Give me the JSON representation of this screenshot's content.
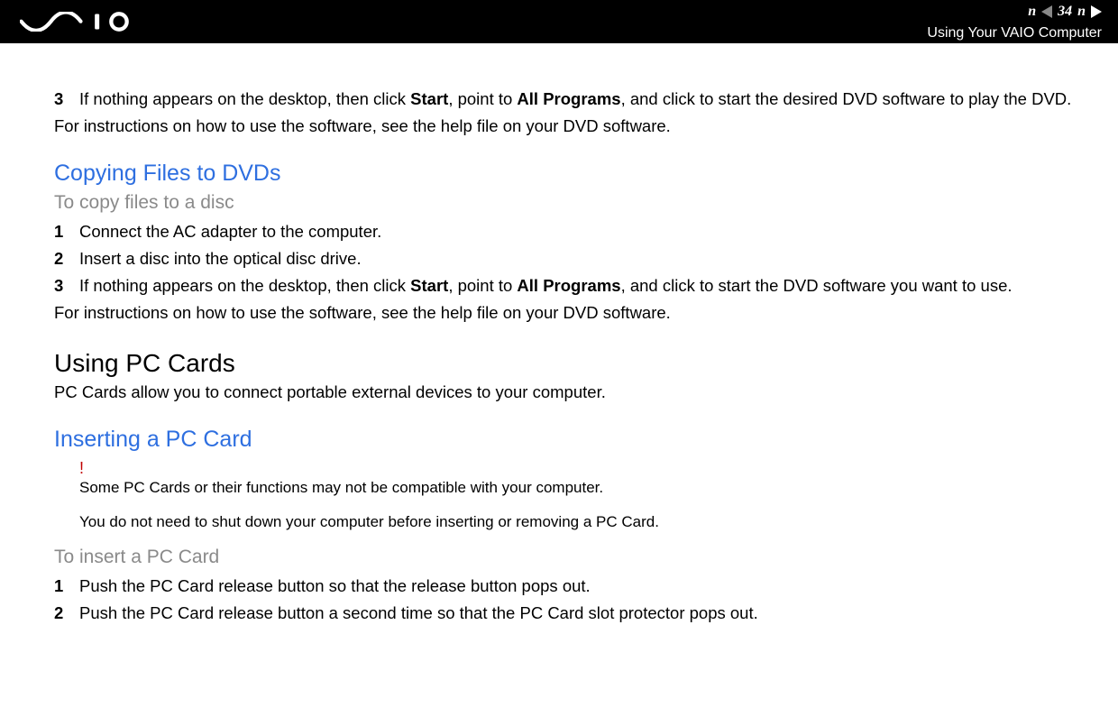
{
  "header": {
    "page_number": "34",
    "n_letter": "n",
    "section": "Using Your VAIO Computer"
  },
  "body": {
    "step3_num": "3",
    "step3_pre": "If nothing appears on the desktop, then click ",
    "step3_b1": "Start",
    "step3_mid1": ", point to ",
    "step3_b2": "All Programs",
    "step3_post": ", and click to start the desired DVD software to play the DVD.",
    "para_help1": "For instructions on how to use the software, see the help file on your DVD software.",
    "h2_copy": "Copying Files to DVDs",
    "h3_copy": "To copy files to a disc",
    "copy1_num": "1",
    "copy1_txt": "Connect the AC adapter to the computer.",
    "copy2_num": "2",
    "copy2_txt": "Insert a disc into the optical disc drive.",
    "copy3_num": "3",
    "copy3_pre": "If nothing appears on the desktop, then click ",
    "copy3_b1": "Start",
    "copy3_mid1": ", point to ",
    "copy3_b2": "All Programs",
    "copy3_post": ", and click to start the DVD software you want to use.",
    "para_help2": "For instructions on how to use the software, see the help file on your DVD software.",
    "h1_pccards": "Using PC Cards",
    "para_pccards": "PC Cards allow you to connect portable external devices to your computer.",
    "h2_insert": "Inserting a PC Card",
    "note_exclaim": "!",
    "note1": "Some PC Cards or their functions may not be compatible with your computer.",
    "note2": "You do not need to shut down your computer before inserting or removing a PC Card.",
    "h3_insert": "To insert a PC Card",
    "ins1_num": "1",
    "ins1_txt": "Push the PC Card release button so that the release button pops out.",
    "ins2_num": "2",
    "ins2_txt": "Push the PC Card release button a second time so that the PC Card slot protector pops out."
  }
}
